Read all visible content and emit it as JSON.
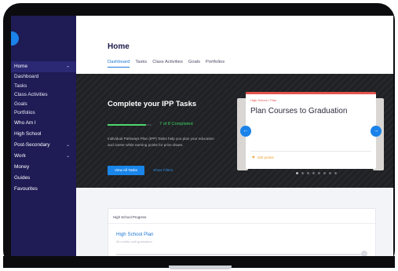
{
  "sidebar": {
    "items": [
      {
        "label": "Home",
        "icon": "chevron-up-icon",
        "active": true
      },
      {
        "label": "Dashboard",
        "sub": true
      },
      {
        "label": "Tasks",
        "sub": true
      },
      {
        "label": "Class Activities",
        "sub": true
      },
      {
        "label": "Goals",
        "sub": true
      },
      {
        "label": "Portfolios",
        "sub": true
      },
      {
        "label": "Who Am I"
      },
      {
        "label": "High School"
      },
      {
        "label": "Post-Secondary",
        "icon": "chevron-down-icon"
      },
      {
        "label": "Work",
        "icon": "chevron-down-icon"
      },
      {
        "label": "Money"
      },
      {
        "label": "Guides"
      },
      {
        "label": "Favourites"
      }
    ],
    "chevron_glyph": "⌄",
    "accent_color": "#1a82e8"
  },
  "header": {
    "title": "Home",
    "tabs": [
      {
        "label": "Dashboard",
        "active": true
      },
      {
        "label": "Tasks"
      },
      {
        "label": "Class Activities"
      },
      {
        "label": "Goals"
      },
      {
        "label": "Portfolios"
      }
    ]
  },
  "hero": {
    "title": "Complete your IPP Tasks",
    "progress_label": "7 of 8 Completed",
    "progress_fraction": 0.875,
    "description": "Individual Pathways Plan (IPP) Tasks help you plan your education and career while earning points for prize draws.",
    "view_all_label": "View All Tasks",
    "show_filters_label": "Show Filters"
  },
  "carousel": {
    "card": {
      "eyebrow": "High School • Plan",
      "title": "Plan Courses to Graduation",
      "points": "100 points",
      "accent_color": "#e4534d"
    },
    "prev_glyph": "←",
    "next_glyph": "→",
    "dot_count": 8,
    "active_dot": 0
  },
  "progress_panel": {
    "heading": "High School Progress",
    "plan_title": "High School Plan",
    "plan_subtitle": "96 credits until graduation"
  }
}
